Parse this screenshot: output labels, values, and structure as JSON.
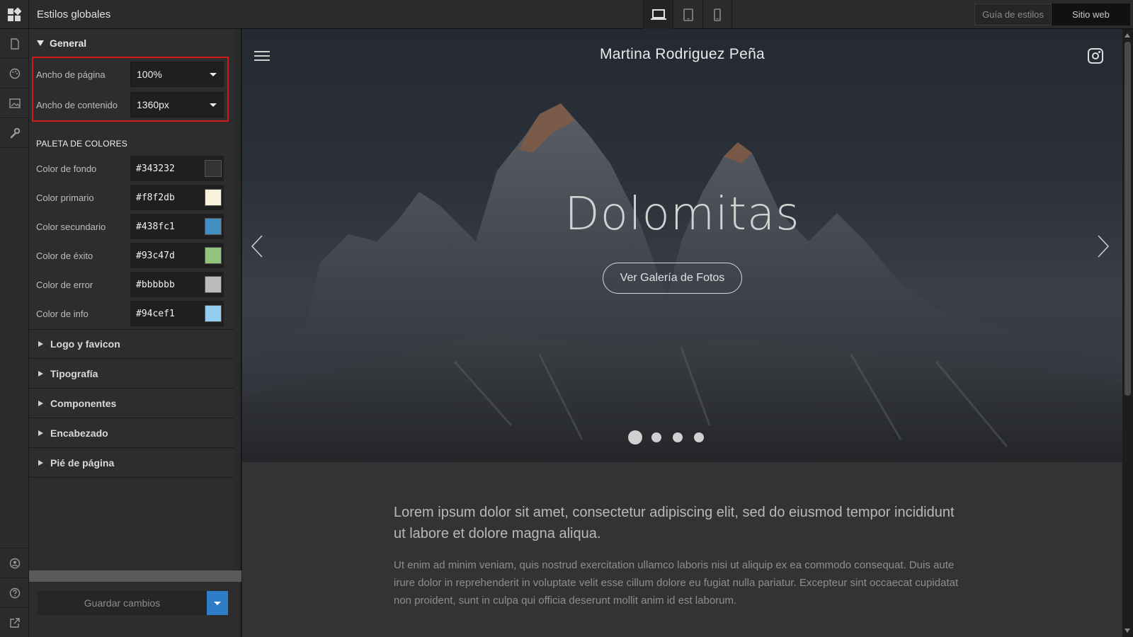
{
  "topbar": {
    "title": "Estilos globales",
    "devices": [
      "desktop-icon",
      "tablet-icon",
      "mobile-icon"
    ],
    "style_guide_label": "Guía de estilos",
    "website_label": "Sitio web"
  },
  "rail": {
    "top_icons": [
      "page-icon",
      "palette-icon",
      "image-icon",
      "wrench-icon"
    ],
    "bottom_icons": [
      "user-icon",
      "help-icon",
      "external-link-icon"
    ]
  },
  "panel": {
    "general": {
      "title": "General",
      "page_width_label": "Ancho de página",
      "page_width_value": "100%",
      "content_width_label": "Ancho de contenido",
      "content_width_value": "1360px"
    },
    "palette": {
      "title": "PALETA DE COLORES",
      "colors": [
        {
          "label": "Color de fondo",
          "hex": "#343232"
        },
        {
          "label": "Color primario",
          "hex": "#f8f2db"
        },
        {
          "label": "Color secundario",
          "hex": "#438fc1"
        },
        {
          "label": "Color de éxito",
          "hex": "#93c47d"
        },
        {
          "label": "Color de error",
          "hex": "#bbbbbb"
        },
        {
          "label": "Color de info",
          "hex": "#94cef1"
        }
      ]
    },
    "sections": [
      "Logo y favicon",
      "Tipografía",
      "Componentes",
      "Encabezado",
      "Pié de página"
    ],
    "save_label": "Guardar cambios"
  },
  "preview": {
    "site_name": "Martina Rodriguez Peña",
    "hero_title": "Dolomitas",
    "hero_cta": "Ver Galería de Fotos",
    "slides_count": 4,
    "active_slide": 1,
    "lead_text": "Lorem ipsum dolor sit amet, consectetur adipiscing elit, sed do eiusmod tempor incididunt ut labore et dolore magna aliqua.",
    "body_text": "Ut enim ad minim veniam, quis nostrud exercitation ullamco laboris nisi ut aliquip ex ea commodo consequat. Duis aute irure dolor in reprehenderit in voluptate velit esse cillum dolore eu fugiat nulla pariatur. Excepteur sint occaecat cupidatat non proident, sunt in culpa qui officia deserunt mollit anim id est laborum."
  },
  "colors": {
    "highlight": "#d11a1a",
    "accent": "#2d7dc9"
  }
}
